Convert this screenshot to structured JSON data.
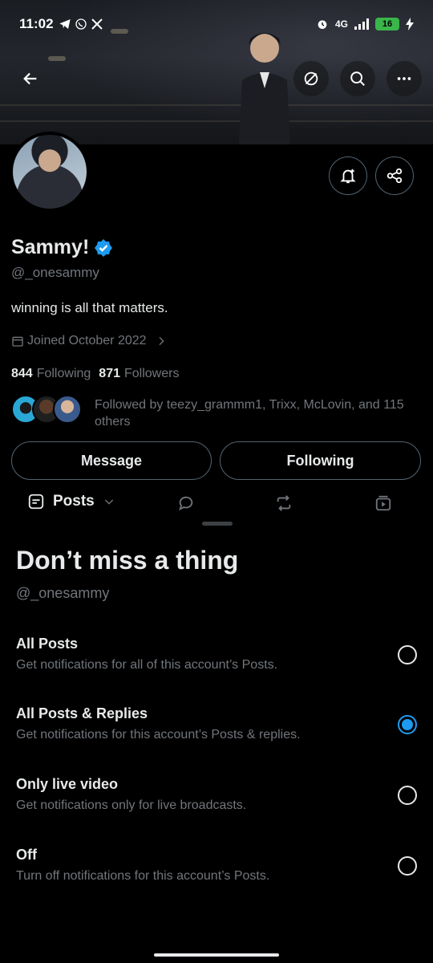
{
  "status_bar": {
    "time": "11:02",
    "network": "4G",
    "battery": "16"
  },
  "profile": {
    "display_name": "Sammy!",
    "handle": "@_onesammy",
    "bio": "winning is all that matters.",
    "joined": "Joined October 2022",
    "following_count": "844",
    "following_label": "Following",
    "followers_count": "871",
    "followers_label": "Followers",
    "followed_by": "Followed by teezy_grammm1, Trixx, McLovin, and 115 others",
    "verified_color": "#1d9bf0"
  },
  "actions": {
    "message_label": "Message",
    "following_label": "Following"
  },
  "tabs": {
    "posts_label": "Posts"
  },
  "sheet": {
    "title": "Don’t miss a thing",
    "handle": "@_onesammy",
    "options": [
      {
        "title": "All Posts",
        "desc": "Get notifications for all of this account’s Posts.",
        "selected": false
      },
      {
        "title": "All Posts & Replies",
        "desc": "Get notifications for this account’s Posts & replies.",
        "selected": true
      },
      {
        "title": "Only live video",
        "desc": "Get notifications only for live broadcasts.",
        "selected": false
      },
      {
        "title": "Off",
        "desc": "Turn off notifications for this account’s Posts.",
        "selected": false
      }
    ]
  },
  "colors": {
    "accent": "#1d9bf0",
    "secondary_text": "#71767b",
    "border": "#536471"
  }
}
